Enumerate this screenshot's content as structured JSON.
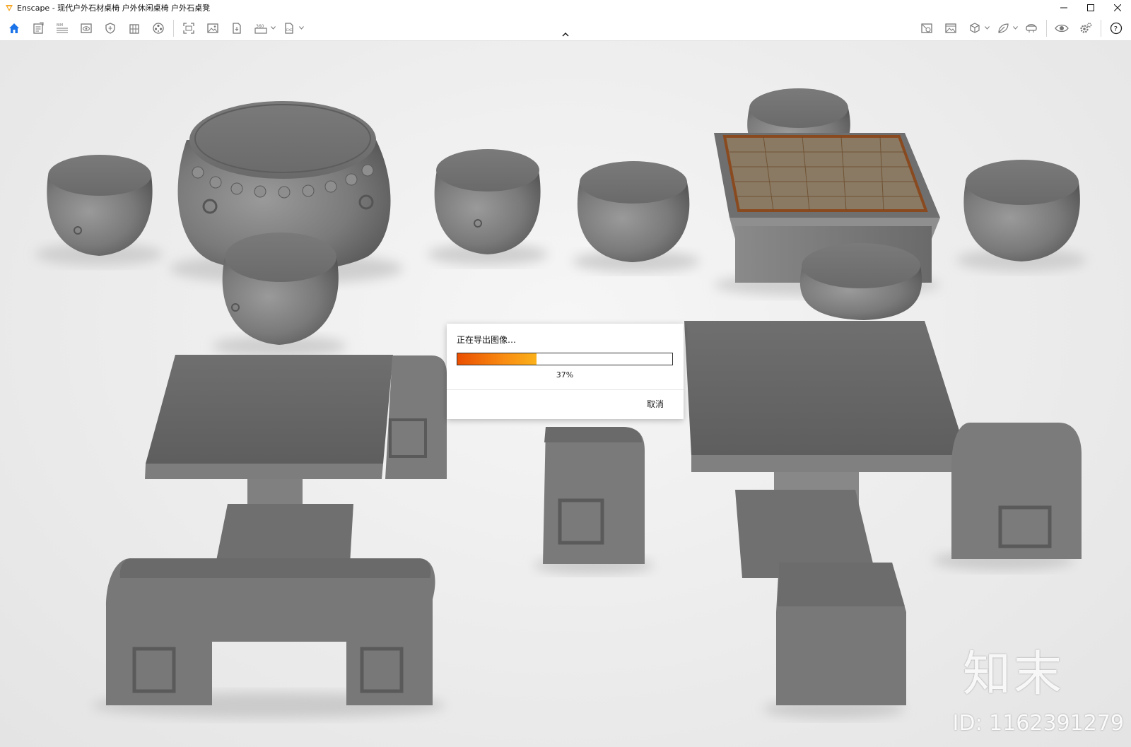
{
  "window": {
    "title": "Enscape - 现代户外石材桌椅 户外休闲桌椅 户外石桌凳"
  },
  "colors": {
    "brand_orange": "#f5a623",
    "home_blue": "#1a73e8",
    "progress_start": "#ea4f00",
    "progress_end": "#fbb11a",
    "stone_gray": "#7a7a7a"
  },
  "toolbar": {
    "left_icons": [
      "home-icon",
      "document-icon",
      "bim-icon",
      "view-icon",
      "shield-icon",
      "building-icon",
      "film-reel-icon",
      "screenshot-icon",
      "image-icon",
      "export-file-icon",
      "panorama-360-icon",
      "exe-export-icon"
    ],
    "right_icons": [
      "image-frame-icon",
      "gallery-icon",
      "cube-icon",
      "leaf-icon",
      "vr-headset-icon",
      "eye-icon",
      "settings-icon",
      "help-icon"
    ]
  },
  "dialog": {
    "title": "正在导出图像…",
    "progress_percent": 37,
    "progress_label": "37%",
    "cancel_label": "取消"
  },
  "watermark": {
    "brand": "知末",
    "id_text": "ID: 1162391279"
  }
}
